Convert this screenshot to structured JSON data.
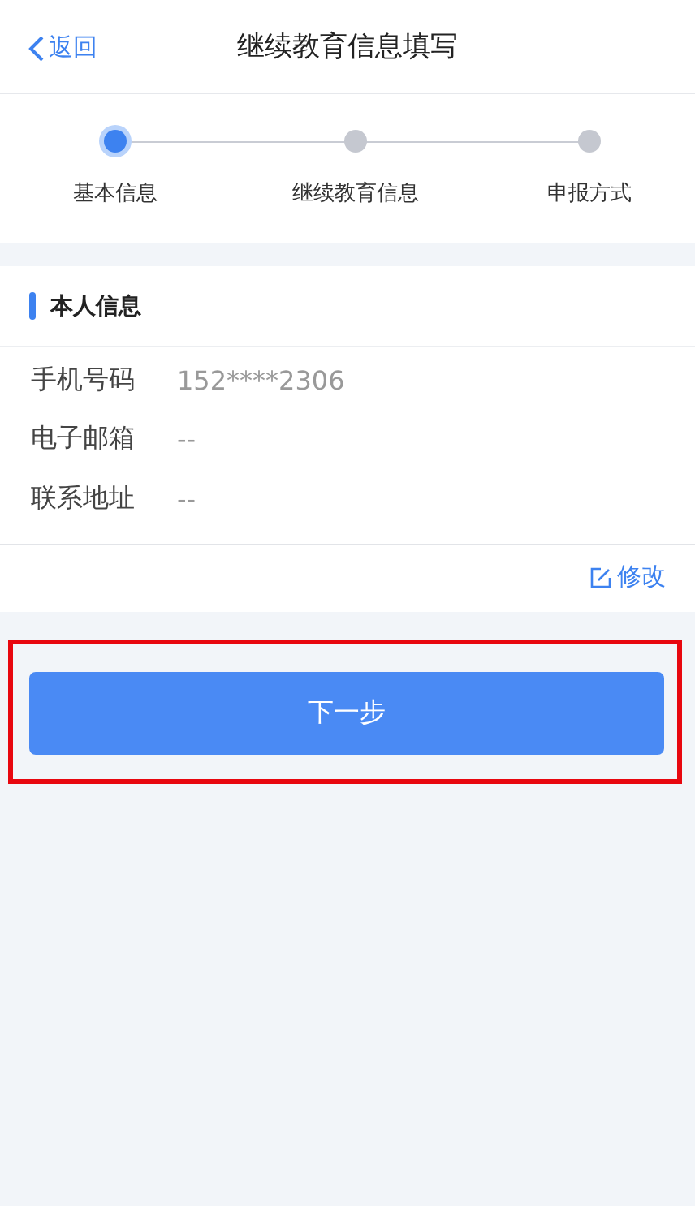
{
  "header": {
    "back": "返回",
    "title": "继续教育信息填写"
  },
  "steps": [
    {
      "label": "基本信息",
      "selected": true
    },
    {
      "label": "继续教育信息",
      "selected": false
    },
    {
      "label": "申报方式",
      "selected": false
    }
  ],
  "section": {
    "title": "本人信息",
    "fields": [
      {
        "label": "手机号码",
        "value": "152****2306"
      },
      {
        "label": "电子邮箱",
        "value": "--"
      },
      {
        "label": "联系地址",
        "value": "--"
      }
    ],
    "edit": "修改"
  },
  "next_button": {
    "label": "下一步",
    "highlighted": true
  }
}
